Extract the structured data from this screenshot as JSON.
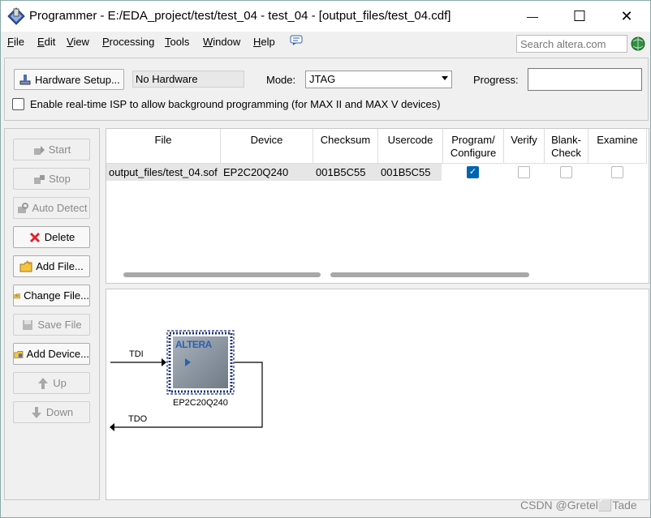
{
  "window": {
    "title": "Programmer - E:/EDA_project/test/test_04 - test_04 - [output_files/test_04.cdf]",
    "minimize_glyph": "—",
    "maximize_glyph": "☐",
    "close_glyph": "✕"
  },
  "menu": {
    "items": [
      {
        "label": "File",
        "u": "F",
        "rest": "ile"
      },
      {
        "label": "Edit",
        "u": "E",
        "rest": "dit"
      },
      {
        "label": "View",
        "u": "V",
        "rest": "iew"
      },
      {
        "label": "Processing",
        "u": "P",
        "rest": "rocessing"
      },
      {
        "label": "Tools",
        "u": "T",
        "rest": "ools"
      },
      {
        "label": "Window",
        "u": "W",
        "rest": "indow"
      },
      {
        "label": "Help",
        "u": "H",
        "rest": "elp"
      }
    ],
    "search_placeholder": "Search altera.com"
  },
  "toolbar": {
    "hardware_setup_label": "Hardware Setup...",
    "hardware_value": "No Hardware",
    "mode_label": "Mode:",
    "mode_value": "JTAG",
    "progress_label": "Progress:",
    "isp_label": "Enable real-time ISP to allow background programming (for MAX II and MAX V devices)",
    "isp_checked": false
  },
  "side_buttons": [
    {
      "label": "Start",
      "icon": "start-icon",
      "enabled": false
    },
    {
      "label": "Stop",
      "icon": "stop-icon",
      "enabled": false
    },
    {
      "label": "Auto Detect",
      "icon": "auto-detect-icon",
      "enabled": false
    },
    {
      "label": "Delete",
      "icon": "delete-icon",
      "enabled": true
    },
    {
      "label": "Add File...",
      "icon": "add-file-icon",
      "enabled": true
    },
    {
      "label": "Change File...",
      "icon": "change-file-icon",
      "enabled": true
    },
    {
      "label": "Save File",
      "icon": "save-file-icon",
      "enabled": false
    },
    {
      "label": "Add Device...",
      "icon": "add-device-icon",
      "enabled": true
    },
    {
      "label": "Up",
      "icon": "up-icon",
      "enabled": false
    },
    {
      "label": "Down",
      "icon": "down-icon",
      "enabled": false
    }
  ],
  "table": {
    "headers": {
      "file": "File",
      "device": "Device",
      "checksum": "Checksum",
      "usercode": "Usercode",
      "program_1": "Program/",
      "program_2": "Configure",
      "verify": "Verify",
      "blank_1": "Blank-",
      "blank_2": "Check",
      "examine": "Examine"
    },
    "row": {
      "file": "output_files/test_04.sof",
      "device": "EP2C20Q240",
      "checksum": "001B5C55",
      "usercode": "001B5C55",
      "program_configure": true,
      "verify": false,
      "blank_check": false,
      "examine": false
    }
  },
  "diagram": {
    "tdi_label": "TDI",
    "tdo_label": "TDO",
    "chip_logo": "ALTERA",
    "chip_name": "EP2C20Q240"
  },
  "watermark": "CSDN @Gretel⬜Tade",
  "colors": {
    "accent": "#0063b1",
    "chip_border": "#1a2f7a"
  }
}
